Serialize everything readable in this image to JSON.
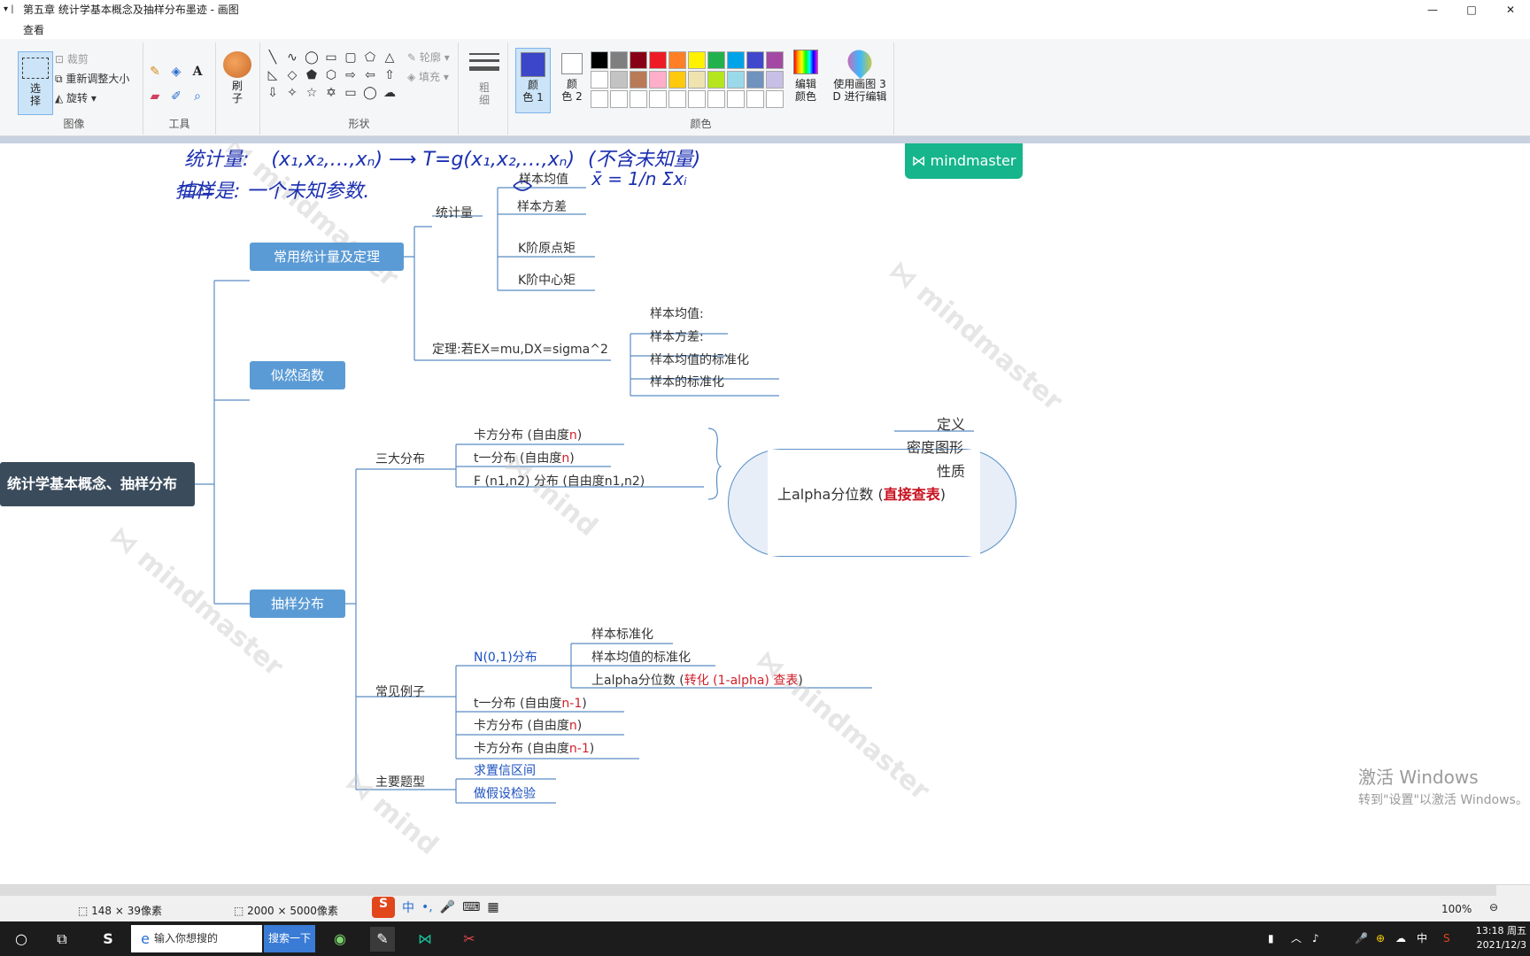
{
  "window": {
    "title": "第五章 统计学基本概念及抽样分布墨迹 - 画图",
    "minimize": "—",
    "maximize": "□",
    "close": "✕"
  },
  "menu": {
    "view_tab": "查看"
  },
  "ribbon": {
    "image": {
      "select": "选\n择",
      "crop": "裁剪",
      "resize": "重新调整大小",
      "rotate": "旋转",
      "label": "图像"
    },
    "tools": {
      "label": "工具"
    },
    "brush": {
      "label": "刷\n子"
    },
    "shapes": {
      "outline": "轮廓",
      "fill": "填充",
      "label": "形状"
    },
    "size": {
      "label": "粗\n细"
    },
    "colors": {
      "color1": "颜\n色 1",
      "color2": "颜\n色 2",
      "edit": "编辑\n颜色",
      "paint3d": "使用画图 3\nD 进行编辑",
      "label": "颜色",
      "color1_value": "#3b46c9",
      "palette": [
        "#000000",
        "#7f7f7f",
        "#880015",
        "#ed1c24",
        "#ff7f27",
        "#fff200",
        "#22b14c",
        "#00a2e8",
        "#3f48cc",
        "#a349a4",
        "#ffffff",
        "#c3c3c3",
        "#b97a57",
        "#ffaec9",
        "#ffc90e",
        "#efe4b0",
        "#b5e61d",
        "#99d9ea",
        "#7092be",
        "#c8bfe7",
        "#ffffff",
        "#ffffff",
        "#ffffff",
        "#ffffff",
        "#ffffff",
        "#ffffff",
        "#ffffff",
        "#ffffff",
        "#ffffff",
        "#ffffff"
      ]
    }
  },
  "canvas": {
    "brand": "mindmaster",
    "handwriting": {
      "line1_label": "统计量:",
      "line1_formula": "(x₁,x₂,…,xₙ) ⟶ T=g(x₁,x₂,…,xₙ)",
      "line1_note": "(不含未知量)",
      "line2": "抽样是: 一个未知参数.",
      "sample_mean_formula": "x̄ = 1/n Σxᵢ"
    },
    "root": "统计学基本概念、抽样分布",
    "branch1": {
      "title": "常用统计量及定理",
      "statistics": {
        "label": "统计量",
        "items": [
          "样本均值",
          "样本方差",
          "K阶原点矩",
          "K阶中心矩"
        ]
      },
      "theorem": {
        "label": "定理:若EX=mu,DX=sigma^2",
        "items": [
          "样本均值:",
          "样本方差:",
          "样本均值的标准化",
          "样本的标准化"
        ]
      }
    },
    "branch2": {
      "title": "似然函数"
    },
    "branch3": {
      "title": "抽样分布",
      "three": {
        "label": "三大分布",
        "chi": {
          "pre": "卡方分布 (自由度",
          "n": "n",
          "post": ")"
        },
        "t": {
          "pre": "t一分布 (自由度",
          "n": "n",
          "post": ")"
        },
        "f": "F (n1,n2) 分布 (自由度n1,n2)",
        "box": {
          "def": "定义",
          "density": "密度图形",
          "property": "性质",
          "alpha_pre": "上alpha分位数 (",
          "alpha_red": "直接查表",
          "alpha_post": ")"
        }
      },
      "examples": {
        "label": "常见例子",
        "normal": "N(0,1)分布",
        "normal_items": {
          "a": "样本标准化",
          "b": "样本均值的标准化",
          "c_pre": "上alpha分位数 (",
          "c_red": "转化 (1-alpha) 查表",
          "c_post": ")"
        },
        "t_n1": {
          "pre": "t一分布 (自由度",
          "n": "n-1",
          "post": ")"
        },
        "chi_n": {
          "pre": "卡方分布 (自由度",
          "n": "n",
          "post": ")"
        },
        "chi_n1": {
          "pre": "卡方分布 (自由度",
          "n": "n-1",
          "post": ")"
        }
      },
      "problems": {
        "label": "主要题型",
        "a": "求置信区间",
        "b": "做假设检验"
      }
    },
    "activate": {
      "title": "激活 Windows",
      "sub": "转到\"设置\"以激活 Windows。"
    }
  },
  "status": {
    "selection": "148 × 39像素",
    "image_size": "2000 × 5000像素",
    "zoom": "100%",
    "ime": [
      "中",
      "•,",
      "🎤",
      "⌨",
      "▦"
    ]
  },
  "taskbar": {
    "search_placeholder": "输入你想搜的",
    "search_button": "搜索一下",
    "tray_lang": "中",
    "time": "13:18 周五",
    "date": "2021/12/3"
  }
}
